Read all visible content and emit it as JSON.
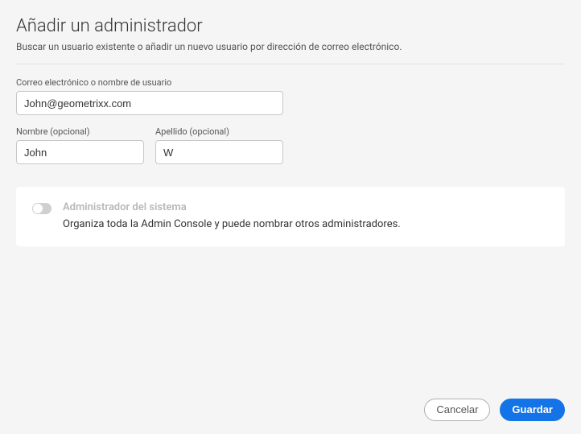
{
  "dialog": {
    "title": "Añadir un administrador",
    "subtitle": "Buscar un usuario existente o añadir un nuevo usuario por dirección de correo electrónico."
  },
  "fields": {
    "email": {
      "label": "Correo electrónico o nombre de usuario",
      "value": "John@geometrixx.com"
    },
    "firstName": {
      "label": "Nombre (opcional)",
      "value": "John"
    },
    "lastName": {
      "label": "Apellido (opcional)",
      "value": "W"
    }
  },
  "adminToggle": {
    "label": "Administrador del sistema",
    "description": "Organiza toda la Admin Console y puede nombrar otros administradores.",
    "enabled": false
  },
  "buttons": {
    "cancel": "Cancelar",
    "save": "Guardar"
  }
}
